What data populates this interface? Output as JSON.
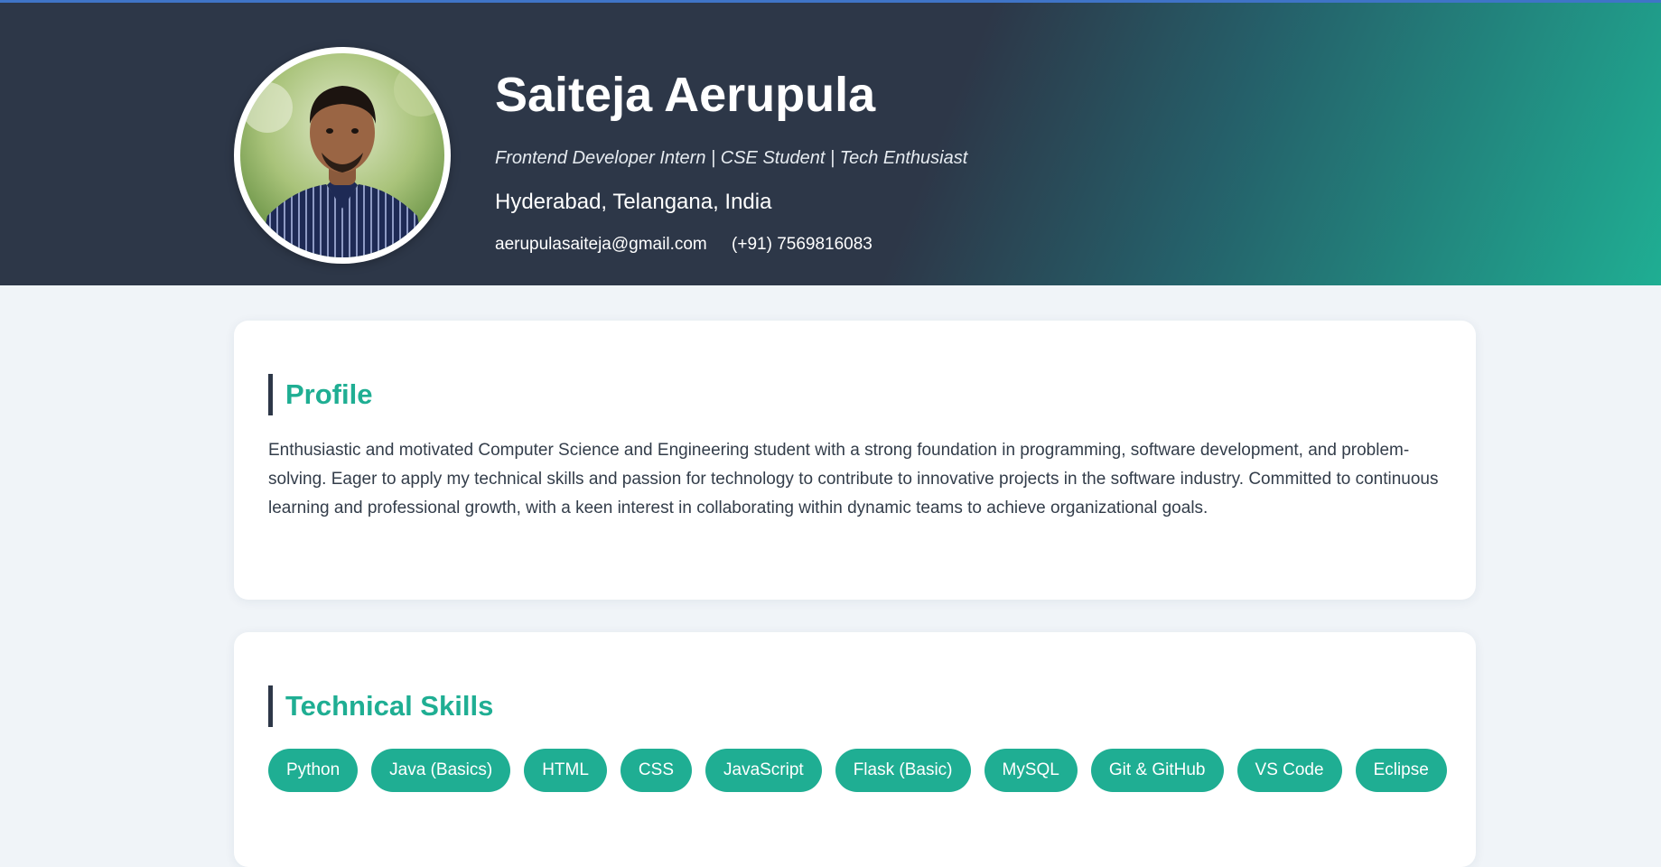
{
  "header": {
    "name": "Saiteja Aerupula",
    "tagline": "Frontend Developer Intern | CSE Student | Tech Enthusiast",
    "location": "Hyderabad, Telangana, India",
    "email": "aerupulasaiteja@gmail.com",
    "phone": "(+91) 7569816083"
  },
  "profile": {
    "title": "Profile",
    "text": "Enthusiastic and motivated Computer Science and Engineering student with a strong foundation in programming, software development, and problem-solving. Eager to apply my technical skills and passion for technology to contribute to innovative projects in the software industry. Committed to continuous learning and professional growth, with a keen interest in collaborating within dynamic teams to achieve organizational goals."
  },
  "skills": {
    "title": "Technical Skills",
    "items": [
      "Python",
      "Java (Basics)",
      "HTML",
      "CSS",
      "JavaScript",
      "Flask (Basic)",
      "MySQL",
      "Git & GitHub",
      "VS Code",
      "Eclipse"
    ]
  },
  "colors": {
    "header_dark": "#2d3748",
    "accent": "#1fae93",
    "page_background": "#f0f4f8"
  }
}
